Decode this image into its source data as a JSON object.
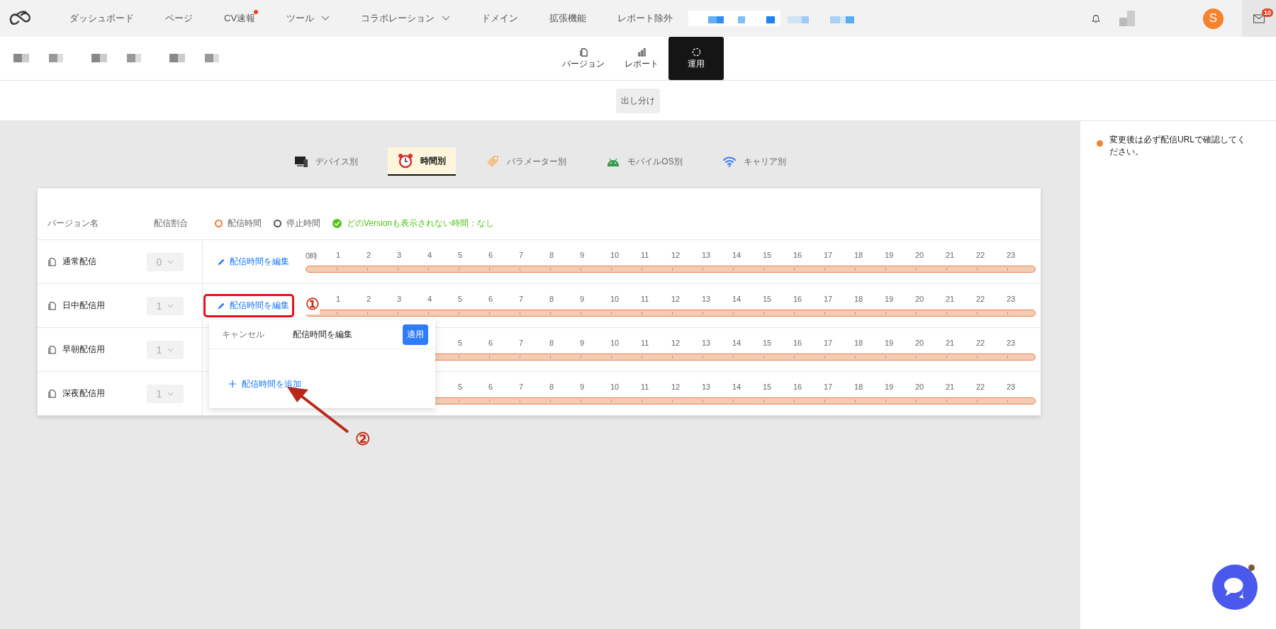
{
  "top_nav": {
    "items": [
      {
        "label": "ダッシュボード",
        "has_menu": false,
        "badge_dot": false
      },
      {
        "label": "ページ",
        "has_menu": false,
        "badge_dot": false
      },
      {
        "label": "CV速報",
        "has_menu": false,
        "badge_dot": true
      },
      {
        "label": "ツール",
        "has_menu": true,
        "badge_dot": false
      },
      {
        "label": "コラボレーション",
        "has_menu": true,
        "badge_dot": false
      },
      {
        "label": "ドメイン",
        "has_menu": false,
        "badge_dot": false
      },
      {
        "label": "拡張機能",
        "has_menu": false,
        "badge_dot": false
      },
      {
        "label": "レポート除外",
        "has_menu": false,
        "badge_dot": false
      }
    ],
    "avatar": "S",
    "mail_badge": "10"
  },
  "view_tabs": [
    {
      "label": "バージョン",
      "kind": "versions",
      "selected": false
    },
    {
      "label": "レポート",
      "kind": "report",
      "selected": false
    },
    {
      "label": "運用",
      "kind": "operation",
      "selected": true
    }
  ],
  "sub_button": "出し分け",
  "segment_tabs": [
    {
      "label": "デバイス別",
      "kind": "device",
      "selected": false
    },
    {
      "label": "時間別",
      "kind": "time",
      "selected": true
    },
    {
      "label": "パラメーター別",
      "kind": "parameter",
      "selected": false
    },
    {
      "label": "モバイルOS別",
      "kind": "os",
      "selected": false
    },
    {
      "label": "キャリア別",
      "kind": "carrier",
      "selected": false
    }
  ],
  "table": {
    "columns": [
      "バージョン名",
      "配信割合"
    ],
    "legend": [
      {
        "label": "配信時間",
        "color": "#f07a3a"
      },
      {
        "label": "停止時間",
        "color": "#555555"
      }
    ],
    "status": "どのVersionも表示されない時間：なし",
    "rows": [
      {
        "name": "通常配信",
        "ratio": "0",
        "disabled": true,
        "edit_link": "配信時間を編集",
        "hours": [
          "0時",
          "1",
          "2",
          "3",
          "4",
          "5",
          "6",
          "7",
          "8",
          "9",
          "10",
          "11",
          "12",
          "13",
          "14",
          "15",
          "16",
          "17",
          "18",
          "19",
          "20",
          "21",
          "22",
          "23"
        ]
      },
      {
        "name": "日中配信用",
        "ratio": "1",
        "disabled": true,
        "edit_link": "配信時間を編集",
        "hours": [
          "1",
          "2",
          "3",
          "4",
          "5",
          "6",
          "7",
          "8",
          "9",
          "10",
          "11",
          "12",
          "13",
          "14",
          "15",
          "16",
          "17",
          "18",
          "19",
          "20",
          "21",
          "22",
          "23"
        ]
      },
      {
        "name": "早朝配信用",
        "ratio": "1",
        "disabled": true,
        "hours": [
          "5",
          "6",
          "7",
          "8",
          "9",
          "10",
          "11",
          "12",
          "13",
          "14",
          "15",
          "16",
          "17",
          "18",
          "19",
          "20",
          "21",
          "22",
          "23"
        ]
      },
      {
        "name": "深夜配信用",
        "ratio": "1",
        "disabled": true,
        "hours": [
          "5",
          "6",
          "7",
          "8",
          "9",
          "10",
          "11",
          "12",
          "13",
          "14",
          "15",
          "16",
          "17",
          "18",
          "19",
          "20",
          "21",
          "22",
          "23"
        ]
      }
    ]
  },
  "popover": {
    "cancel": "キャンセル",
    "title": "配信時間を編集",
    "apply": "適用",
    "add_link": "配信時間を追加"
  },
  "annotations": {
    "marker_1": "①",
    "marker_2": "②"
  },
  "notice": "変更後は必ず配信URLで確認してください。"
}
